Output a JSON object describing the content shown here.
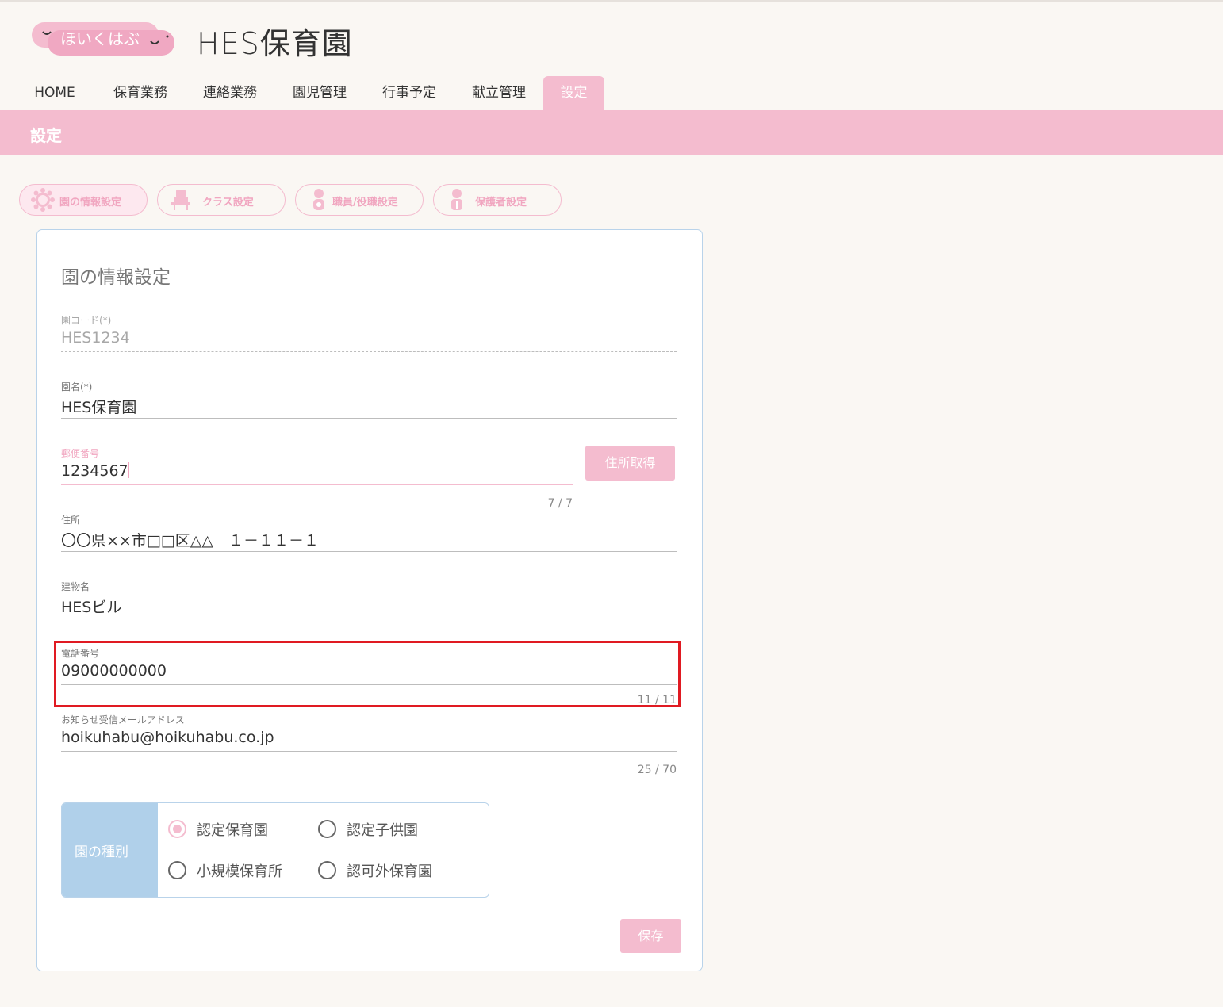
{
  "header": {
    "logo_text": "ほいくはぶ",
    "site_title": "HES保育園"
  },
  "nav": {
    "items": [
      {
        "label": "HOME"
      },
      {
        "label": "保育業務"
      },
      {
        "label": "連絡業務"
      },
      {
        "label": "園児管理"
      },
      {
        "label": "行事予定"
      },
      {
        "label": "献立管理"
      },
      {
        "label": "設定"
      }
    ],
    "active_index": 6
  },
  "band": {
    "title": "設定"
  },
  "subtabs": [
    {
      "label": "園の情報設定",
      "icon": "sun-icon"
    },
    {
      "label": "クラス設定",
      "icon": "teacher-desk-icon"
    },
    {
      "label": "職員/役職設定",
      "icon": "staff-person-icon"
    },
    {
      "label": "保護者設定",
      "icon": "parent-person-icon"
    }
  ],
  "form": {
    "title": "園の情報設定",
    "en_code": {
      "label": "園コード(*)",
      "value": "HES1234"
    },
    "en_name": {
      "label": "園名(*)",
      "value": "HES保育園"
    },
    "postal": {
      "label": "郵便番号",
      "value": "1234567",
      "counter": "7 / 7",
      "button": "住所取得"
    },
    "address": {
      "label": "住所",
      "value": "〇〇県××市□□区△△　１－１１－１"
    },
    "building": {
      "label": "建物名",
      "value": "HESビル"
    },
    "phone": {
      "label": "電話番号",
      "value": "09000000000",
      "counter": "11 / 11"
    },
    "email": {
      "label": "お知らせ受信メールアドレス",
      "value": "hoikuhabu@hoikuhabu.co.jp",
      "counter": "25 / 70"
    },
    "type": {
      "label": "園の種別",
      "options": [
        {
          "label": "認定保育園",
          "checked": true
        },
        {
          "label": "認定子供園",
          "checked": false
        },
        {
          "label": "小規模保育所",
          "checked": false
        },
        {
          "label": "認可外保育園",
          "checked": false
        }
      ]
    },
    "save_label": "保存"
  },
  "colors": {
    "accent_pink": "#f4bccf",
    "label_pink": "#f1a6c0",
    "accent_blue": "#b0d0ea",
    "highlight_red": "#e01a22",
    "background": "#faf7f3"
  }
}
